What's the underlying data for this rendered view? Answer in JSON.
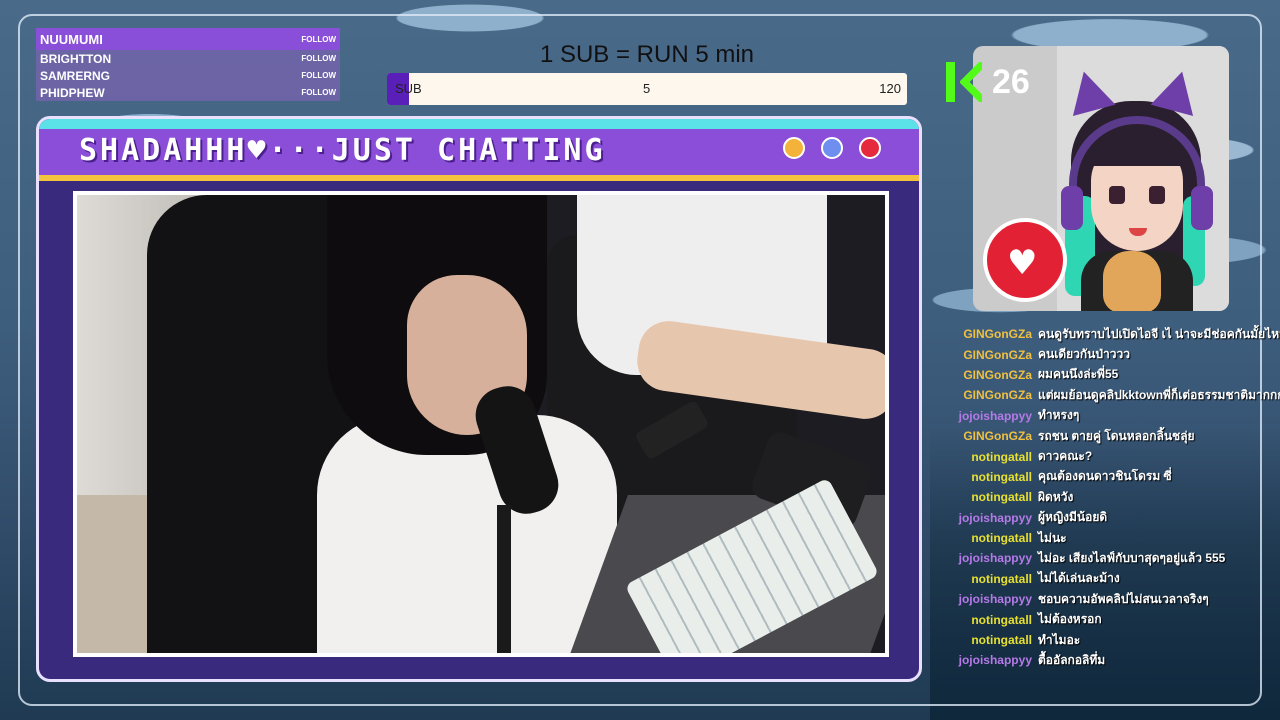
{
  "followers": [
    {
      "name": "NUUMUMI",
      "tag": "FOLLOW"
    },
    {
      "name": "BRIGHTTON",
      "tag": "FOLLOW"
    },
    {
      "name": "SAMRERNG",
      "tag": "FOLLOW"
    },
    {
      "name": "PHIDPHEW",
      "tag": "FOLLOW"
    }
  ],
  "goal": {
    "title": "1 SUB = RUN 5 min",
    "label": "SUB",
    "current": "5",
    "max": "120",
    "progress_fraction": 0.04167,
    "fill_color": "#5a1fb8"
  },
  "kick": {
    "count": "26",
    "logo_icon": "kick-logo-icon",
    "color": "#53fc18"
  },
  "window": {
    "title": "SHADAHHH♥···JUST CHATTING",
    "accent": "#8a4ed8",
    "stripe": "#f3c33d",
    "dots": [
      "#f3b23a",
      "#6e8ef0",
      "#e42a3c"
    ]
  },
  "chat": [
    {
      "user": "GINGonGZa",
      "color": "#f0c040",
      "text": "คนดูรับทราบไปเปิดไอจี เไ น่าจะมีช่อคกันมั้ยไหม"
    },
    {
      "user": "GINGonGZa",
      "color": "#f0c040",
      "text": "คนเดียวกันป่าววว"
    },
    {
      "user": "GINGonGZa",
      "color": "#f0c040",
      "text": "ผมคนนึงล่ะพี่55"
    },
    {
      "user": "GINGonGZa",
      "color": "#f0c040",
      "text": "แต่ผมย้อนดูคลิปkktownพี่ก็เต่อธรรมชาติมากกกก"
    },
    {
      "user": "jojoishappyy",
      "color": "#b57ae8",
      "text": "ทำหรงๆ"
    },
    {
      "user": "GINGonGZa",
      "color": "#f0c040",
      "text": "รถชน ตายคู่ โดนหลอกลิ้นชลุ่ย"
    },
    {
      "user": "notingatall",
      "color": "#e8e030",
      "text": "ดาวคณะ?"
    },
    {
      "user": "notingatall",
      "color": "#e8e030",
      "text": "คุณต้องดนดาวชินโดรม ซี่"
    },
    {
      "user": "notingatall",
      "color": "#e8e030",
      "text": "ผิดหวัง"
    },
    {
      "user": "jojoishappyy",
      "color": "#b57ae8",
      "text": "ผู้หญิงมีน้อยดิ"
    },
    {
      "user": "notingatall",
      "color": "#e8e030",
      "text": "ไม่นะ"
    },
    {
      "user": "jojoishappyy",
      "color": "#b57ae8",
      "text": "ไม่อะ เสียงไลฟ์กับบาสุดๆอยู่แล้ว 555"
    },
    {
      "user": "notingatall",
      "color": "#e8e030",
      "text": "ไม่ได้เล่นละม้าง"
    },
    {
      "user": "jojoishappyy",
      "color": "#b57ae8",
      "text": "ชอบความอัพคลิปไม่สนเวลาจริงๆ"
    },
    {
      "user": "notingatall",
      "color": "#e8e030",
      "text": "ไม่ต้องหรอก"
    },
    {
      "user": "notingatall",
      "color": "#e8e030",
      "text": "ทำไมอะ"
    },
    {
      "user": "jojoishappyy",
      "color": "#b57ae8",
      "text": "ตื้ออัลกอลิทึ่ม"
    }
  ]
}
